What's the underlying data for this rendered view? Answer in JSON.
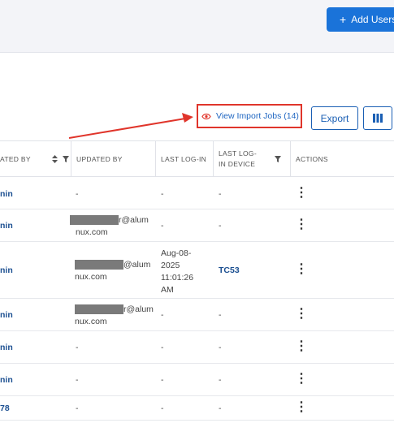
{
  "header": {
    "add_users_label": "Add Users"
  },
  "toolbar": {
    "view_import_jobs": "View Import Jobs (14)",
    "export_label": "Export"
  },
  "table": {
    "columns": [
      "ATED BY",
      "UPDATED BY",
      "LAST LOG-IN",
      "LAST LOG-IN DEVICE",
      "ACTIONS"
    ],
    "last_login_device_line1": "LAST LOG-",
    "last_login_device_line2": "IN DEVICE",
    "rows": [
      {
        "created_by": "nin",
        "updated_by": "-",
        "updated_by_line2": "",
        "last_login": "-",
        "last_login_lines": [],
        "device": "-"
      },
      {
        "created_by": "nin",
        "updated_by": "r@alum",
        "updated_by_line2": "nux.com",
        "last_login": "-",
        "last_login_lines": [],
        "device": "-"
      },
      {
        "created_by": "nin",
        "updated_by": "@alum",
        "updated_by_line2": "nux.com",
        "last_login": "",
        "last_login_lines": [
          "Aug-08-",
          "2025",
          "11:01:26",
          "AM"
        ],
        "device": "TC53"
      },
      {
        "created_by": "nin",
        "updated_by": "r@alum",
        "updated_by_line2": "nux.com",
        "last_login": "-",
        "last_login_lines": [],
        "device": "-"
      },
      {
        "created_by": "nin",
        "updated_by": "-",
        "updated_by_line2": "",
        "last_login": "-",
        "last_login_lines": [],
        "device": "-"
      },
      {
        "created_by": "nin",
        "updated_by": "-",
        "updated_by_line2": "",
        "last_login": "-",
        "last_login_lines": [],
        "device": "-"
      },
      {
        "created_by": "78",
        "updated_by": "-",
        "updated_by_line2": "",
        "last_login": "-",
        "last_login_lines": [],
        "device": "-"
      }
    ]
  },
  "colors": {
    "accent": "#1a73d9",
    "highlight": "#e0352b",
    "link": "#1b4f91"
  },
  "icons": [
    "plus-icon",
    "eye-icon",
    "columns-icon",
    "sort-icon",
    "filter-icon",
    "kebab-icon"
  ]
}
